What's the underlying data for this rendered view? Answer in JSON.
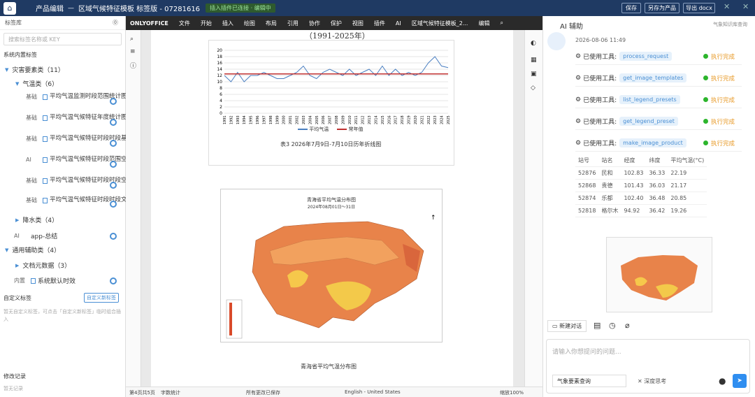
{
  "titlebar": {
    "app": "产品编辑",
    "doc": "区域气候特征模板 标签版 - 07281616",
    "status": "插入插件已连接 · 编辑中",
    "save": "保存",
    "saveas": "另存为产品",
    "export": "导出 docx"
  },
  "left": {
    "title": "标签库",
    "search_placeholder": "搜索标签名称或 KEY",
    "builtin_title": "系统内置标签",
    "groups": [
      {
        "label": "灾害要素类（11）"
      },
      {
        "label": "气温类（6）"
      }
    ],
    "leaves": [
      {
        "badge": "基础",
        "text": "平均气温监测时段范围统计图(年平均气…"
      },
      {
        "badge": "基础",
        "text": "平均气温气候特征年度统计图(年平均气…"
      },
      {
        "badge": "基础",
        "text": "平均气温气候特征时段时段基础统计表"
      },
      {
        "badge": "AI",
        "text": "平均气温气候特征时段范围空间分布图…"
      },
      {
        "badge": "基础",
        "text": "平均气温气候特征时段时段空间分布图…"
      },
      {
        "badge": "基础",
        "text": "平均气温气候特征时段时段文字描述"
      }
    ],
    "rain": "降水类（4）",
    "app": "app-总结",
    "general": "通用辅助类（4）",
    "meta": "文档元数据（3）",
    "sysdate": "系统默认时效",
    "inner": "内置",
    "custom_title": "自定义标签",
    "custom_btn": "自定义新标签",
    "custom_empty": "暂无自定义标签，可点击「自定义新标签」临时组合插入",
    "history_title": "修改记录",
    "history_empty": "暂无记录"
  },
  "editor": {
    "brand": "ONLYOFFICE",
    "menus": [
      "文件",
      "开始",
      "插入",
      "绘图",
      "布局",
      "引用",
      "协作",
      "保护",
      "视图",
      "插件",
      "AI",
      "区域气候特征模板_2..."
    ],
    "edit": "编辑",
    "chart_title": "（1991-2025年）",
    "legend_a": "平均气温",
    "legend_b": "常年值",
    "caption1": "表3 2026年7月9日-7月10日历年折线图",
    "map_title": "青海省平均气温分布图",
    "map_sub": "2024年08月01日～31日",
    "caption2": "青海省平均气温分布图"
  },
  "status": {
    "page": "第4页共5页",
    "words": "字数统计",
    "saved": "所有更改已保存",
    "lang": "English - United States",
    "zoom": "缩放100%"
  },
  "right": {
    "title": "AI 辅助",
    "link": "气象知识库查询",
    "time": "2026-08-06 11:49",
    "used": "已使用工具:",
    "tools": [
      "process_request",
      "get_image_templates",
      "list_legend_presets",
      "get_legend_preset",
      "make_image_product"
    ],
    "done": "执行完成",
    "table_head": [
      "站号",
      "站名",
      "经度",
      "纬度",
      "平均气温(°C)"
    ],
    "rows": [
      [
        "52876",
        "民和",
        "102.83",
        "36.33",
        "22.19"
      ],
      [
        "52868",
        "贵德",
        "101.43",
        "36.03",
        "21.17"
      ],
      [
        "52874",
        "乐都",
        "102.40",
        "36.48",
        "20.85"
      ],
      [
        "52818",
        "格尔木",
        "94.92",
        "36.42",
        "19.26"
      ]
    ],
    "new_chat": "新建对话",
    "input_placeholder": "请输入你想提问的问题...",
    "mode": "气象要素查询",
    "deep": "深度思考"
  },
  "chart_data": {
    "type": "line",
    "x": [
      "1991",
      "1992",
      "1993",
      "1994",
      "1995",
      "1996",
      "1997",
      "1998",
      "1999",
      "2000",
      "2001",
      "2002",
      "2003",
      "2004",
      "2005",
      "2006",
      "2007",
      "2008",
      "2009",
      "2010",
      "2011",
      "2012",
      "2013",
      "2014",
      "2015",
      "2016",
      "2017",
      "2018",
      "2019",
      "2020",
      "2021",
      "2022",
      "2023",
      "2024",
      "2025"
    ],
    "series": [
      {
        "name": "平均气温",
        "values": [
          12,
          10,
          13,
          10,
          12,
          12,
          13,
          12,
          11,
          11,
          12,
          13,
          15,
          12,
          11,
          13,
          14,
          13,
          12,
          14,
          12,
          13,
          14,
          12,
          15,
          12,
          14,
          12,
          13,
          12,
          13,
          16,
          18,
          15,
          14.5
        ]
      },
      {
        "name": "常年值",
        "values": [
          12.5,
          12.5,
          12.5,
          12.5,
          12.5,
          12.5,
          12.5,
          12.5,
          12.5,
          12.5,
          12.5,
          12.5,
          12.5,
          12.5,
          12.5,
          12.5,
          12.5,
          12.5,
          12.5,
          12.5,
          12.5,
          12.5,
          12.5,
          12.5,
          12.5,
          12.5,
          12.5,
          12.5,
          12.5,
          12.5,
          12.5,
          12.5,
          12.5,
          12.5,
          12.5
        ]
      }
    ],
    "ylim": [
      0,
      20
    ],
    "yticks": [
      0,
      2,
      4,
      6,
      8,
      10,
      12,
      14,
      16,
      18,
      20
    ],
    "colors": [
      "#4a7fc1",
      "#c03030"
    ]
  }
}
